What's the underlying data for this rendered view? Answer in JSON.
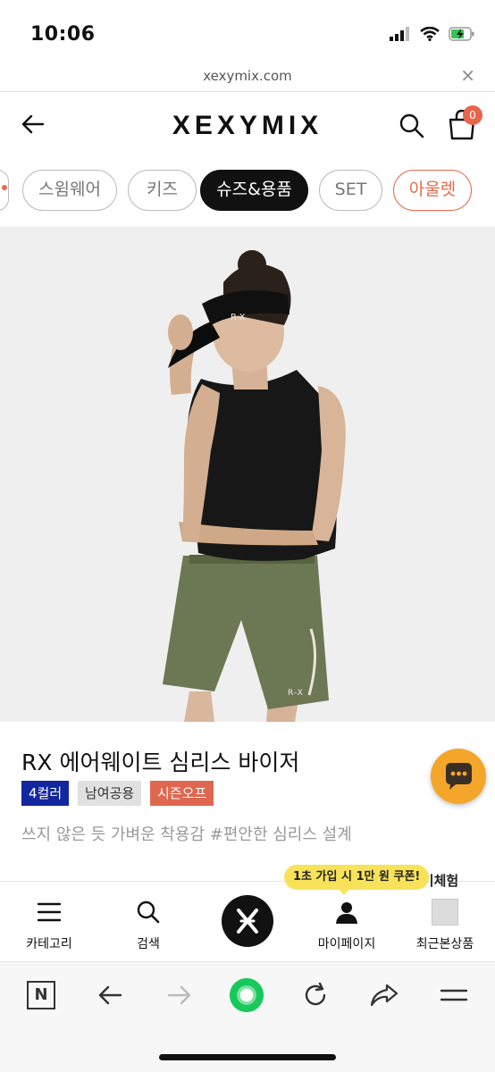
{
  "status_bar": {
    "time": "10:06"
  },
  "url_bar": {
    "domain": "xexymix.com",
    "close": "×"
  },
  "header": {
    "logo": "XEXYMIX",
    "cart_count": "0"
  },
  "categories": [
    {
      "label": "스윔웨어"
    },
    {
      "label": "키즈"
    },
    {
      "label": "슈즈&용품",
      "active": true
    },
    {
      "label": "SET"
    },
    {
      "label": "아울렛",
      "accent": "#e46a4b"
    }
  ],
  "product": {
    "title": "RX 에어웨이트 심리스 바이저",
    "tags": {
      "color": "4컬러",
      "gender": "남여공용",
      "season": "시즌오프"
    },
    "subtitle": "쓰지 않은 듯 가벼운 착용감 #편안한 심리스 설계",
    "visor_logo": "R-X"
  },
  "promo": {
    "coupon": "1초 가입 시 1만 원 쿠폰!",
    "peek": "후기체험"
  },
  "bottom_nav": [
    {
      "label": "카테고리",
      "icon": "menu-icon"
    },
    {
      "label": "검색",
      "icon": "search-icon"
    },
    {
      "label": "",
      "icon": "brand-logo-icon"
    },
    {
      "label": "마이페이지",
      "icon": "person-icon"
    },
    {
      "label": "최근본상품",
      "icon": "recent-product-thumbnail"
    }
  ],
  "browser_toolbar": {
    "n_label": "N",
    "icons": [
      "naver-n-icon",
      "back-arrow-icon",
      "forward-arrow-icon",
      "green-dot-icon",
      "refresh-icon",
      "share-icon",
      "menu-icon"
    ]
  },
  "colors": {
    "accent": "#e46a4b",
    "tag_blue": "#1226a0",
    "coupon_yellow": "#f7e25a",
    "chat_orange": "#f4a62b",
    "naver_green": "#19c85a"
  }
}
